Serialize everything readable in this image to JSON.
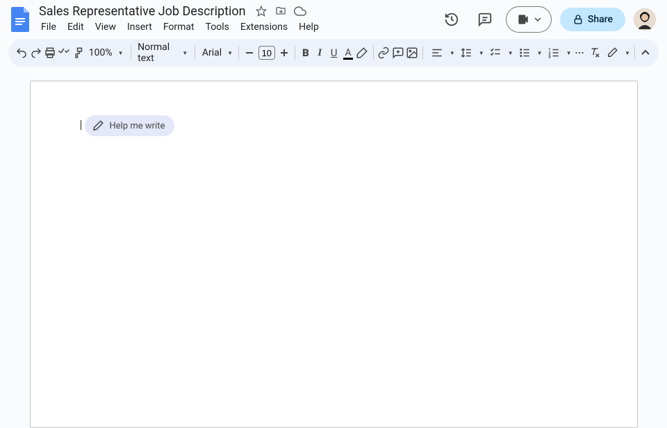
{
  "doc": {
    "title": "Sales Representative Job Description"
  },
  "menu": {
    "file": "File",
    "edit": "Edit",
    "view": "View",
    "insert": "Insert",
    "format": "Format",
    "tools": "Tools",
    "extensions": "Extensions",
    "help": "Help"
  },
  "header": {
    "share": "Share"
  },
  "toolbar": {
    "zoom": "100%",
    "style": "Normal text",
    "font": "Arial",
    "font_size": "10"
  },
  "suggestion": {
    "help_write": "Help me write"
  }
}
